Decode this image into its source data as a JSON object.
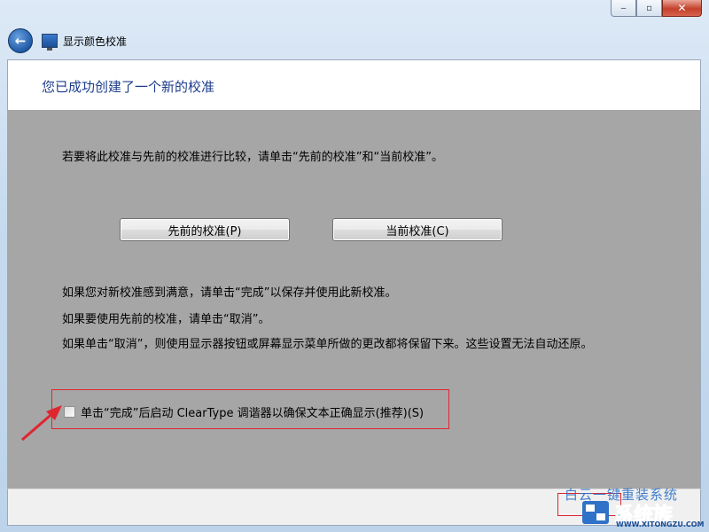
{
  "window": {
    "title": "显示颜色校准",
    "controls": {
      "minimize": "‒",
      "maximize": "▫",
      "close": "✕"
    }
  },
  "header": {
    "headline": "您已成功创建了一个新的校准"
  },
  "content": {
    "compare_text": "若要将此校准与先前的校准进行比较，请单击“先前的校准”和“当前校准”。",
    "previous_button": "先前的校准(P)",
    "current_button": "当前校准(C)",
    "satisfied_text": "如果您对新校准感到满意，请单击“完成”以保存并使用此新校准。",
    "use_previous_text": "如果要使用先前的校准，请单击“取消”。",
    "cancel_note_text": "如果单击“取消”，则使用显示器按钮或屏幕显示菜单所做的更改都将保留下来。这些设置无法自动还原。",
    "cleartype_checkbox_label": "单击“完成”后启动 ClearType 调谐器以确保文本正确显示(推荐)(S)",
    "cleartype_checked": false
  },
  "watermark": {
    "top": "白云一键重装系统",
    "brand": "系统族",
    "url": "WWW.XITONGZU.COM"
  },
  "colors": {
    "accent": "#1e3e8c",
    "highlight": "#e0252f",
    "body_gray": "#a6a6a6"
  }
}
